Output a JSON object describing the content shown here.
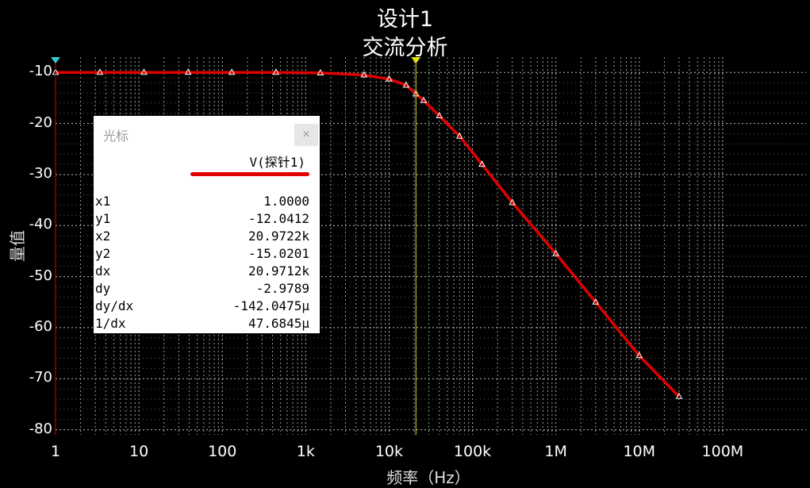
{
  "title": "设计1",
  "subtitle": "交流分析",
  "chart_data": {
    "type": "line",
    "title": "设计1",
    "subtitle": "交流分析",
    "xlabel": "频率（Hz）",
    "ylabel": "量值",
    "xscale": "log",
    "xlim": [
      1,
      1000000000
    ],
    "ylim": [
      -81,
      -7
    ],
    "xticks": [
      "1",
      "10",
      "100",
      "1k",
      "10k",
      "100k",
      "1M",
      "10M",
      "100M"
    ],
    "yticks": [
      "-10",
      "-20",
      "-30",
      "-40",
      "-50",
      "-60",
      "-70",
      "-80"
    ],
    "grid": true,
    "series": [
      {
        "name": "V(探针1)",
        "color": "#e00000",
        "x": [
          1,
          3.4,
          11.5,
          39,
          130,
          440,
          1500,
          5000,
          10000,
          16000,
          20972,
          26000,
          40000,
          70000,
          130000,
          300000,
          1000000,
          3000000,
          10000000,
          30000000
        ],
        "y": [
          -10,
          -10,
          -10,
          -10,
          -10,
          -10,
          -10.1,
          -10.5,
          -11.3,
          -12.5,
          -14.2,
          -15.5,
          -18.5,
          -22.5,
          -28,
          -35.5,
          -45.5,
          -55,
          -65.5,
          -73.5
        ]
      }
    ],
    "cursors": [
      {
        "label": "1",
        "x": 1,
        "color": "#e00000"
      },
      {
        "label": "2",
        "x": 20972.2,
        "color": "#e8e800"
      }
    ]
  },
  "cursor_panel": {
    "title": "光标",
    "close": "×",
    "column": "V(探针1)",
    "rows": [
      {
        "k": "x1",
        "v": "1.0000"
      },
      {
        "k": "y1",
        "v": "-12.0412"
      },
      {
        "k": "x2",
        "v": "20.9722k"
      },
      {
        "k": "y2",
        "v": "-15.0201"
      },
      {
        "k": "dx",
        "v": "20.9712k"
      },
      {
        "k": "dy",
        "v": "-2.9789"
      },
      {
        "k": "dy/dx",
        "v": "-142.0475μ"
      },
      {
        "k": "1/dx",
        "v": "47.6845μ"
      }
    ]
  }
}
